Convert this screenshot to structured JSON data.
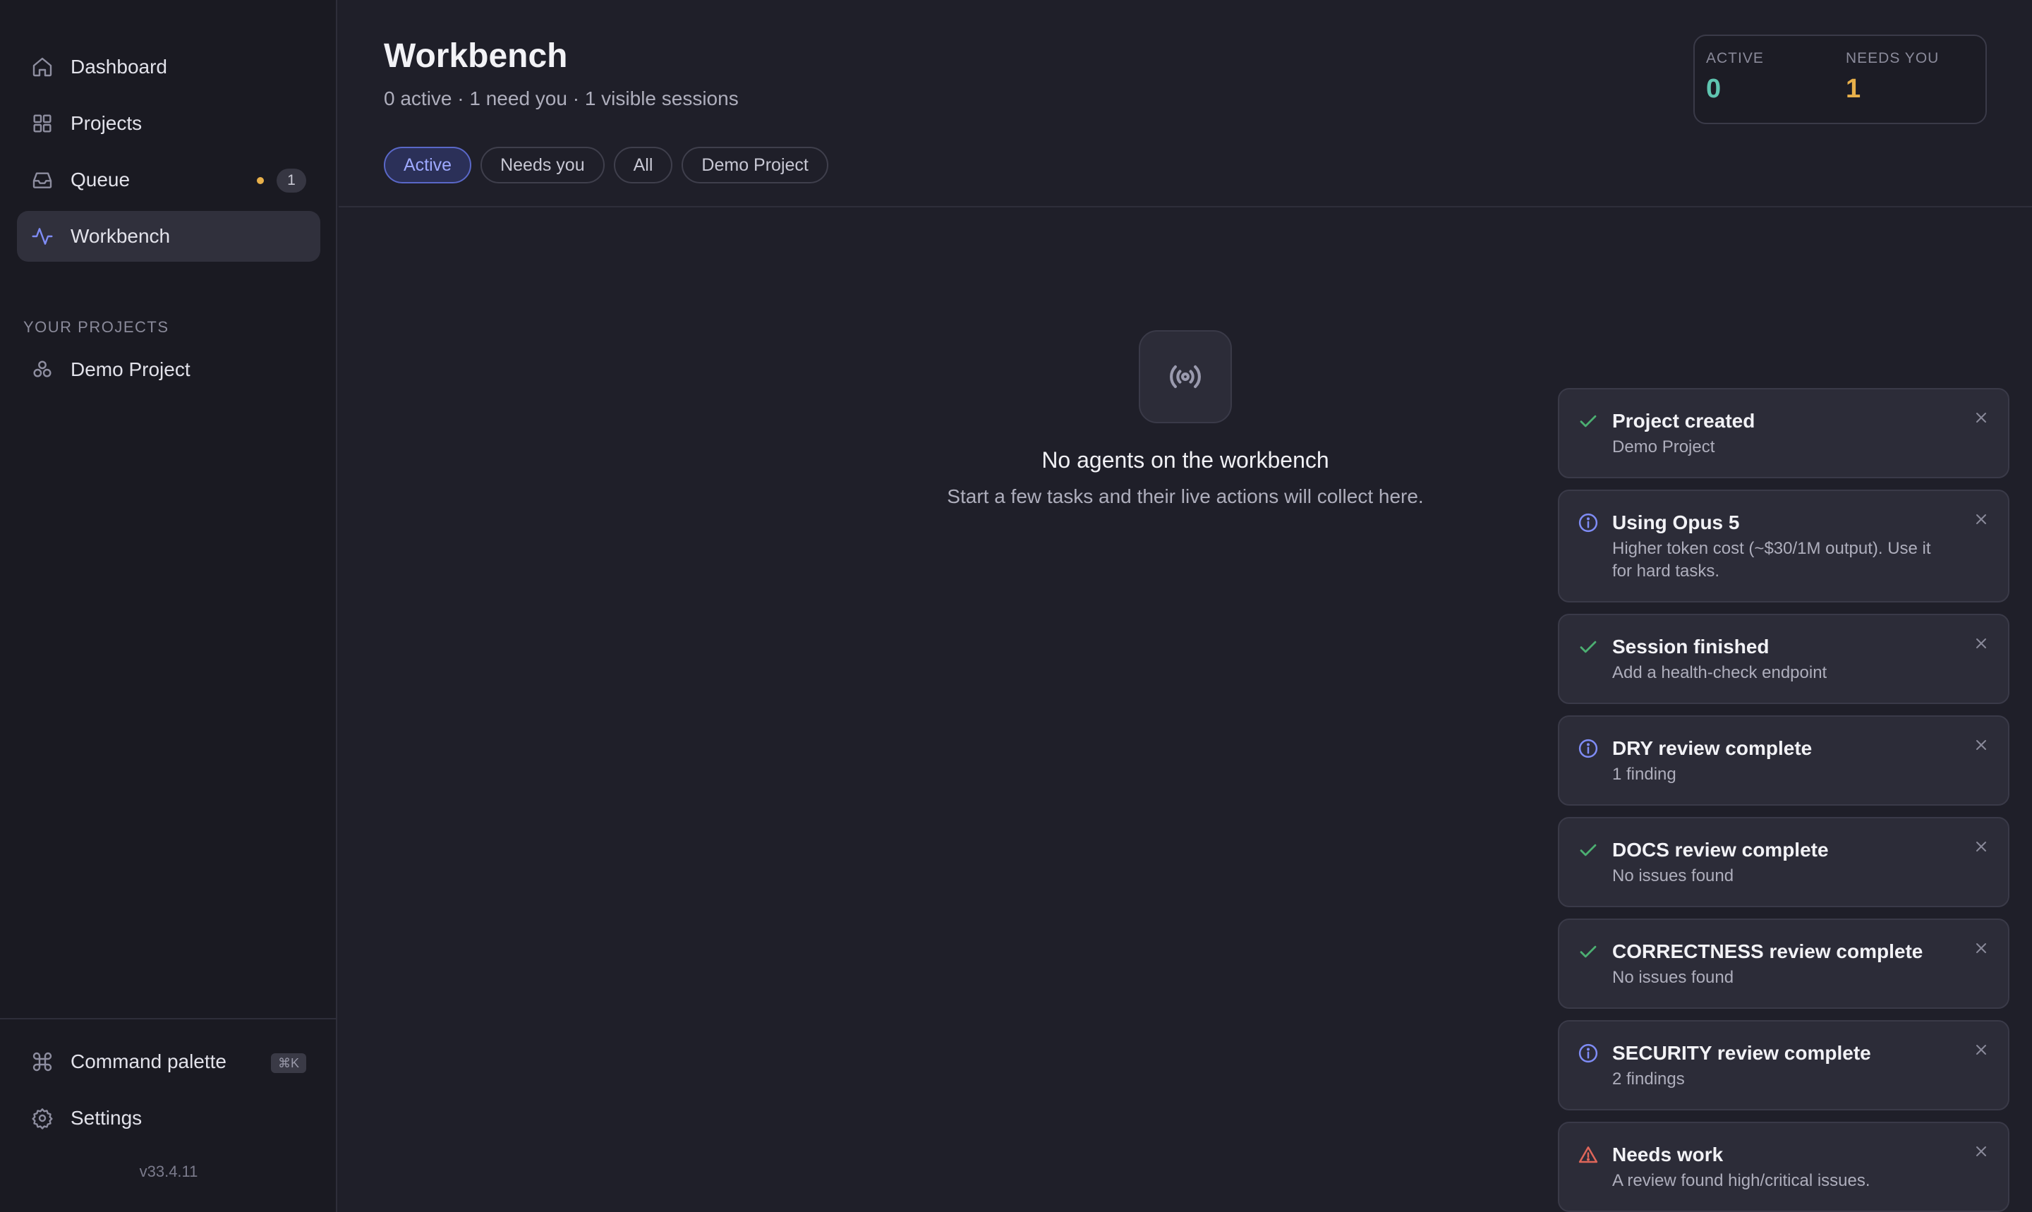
{
  "sidebar": {
    "nav": [
      {
        "label": "Dashboard",
        "icon": "home-icon"
      },
      {
        "label": "Projects",
        "icon": "grid-icon"
      },
      {
        "label": "Queue",
        "icon": "inbox-icon",
        "badge": "1"
      },
      {
        "label": "Workbench",
        "icon": "activity-icon",
        "active": true
      }
    ],
    "section_label": "YOUR PROJECTS",
    "projects": [
      {
        "label": "Demo Project",
        "icon": "cluster-icon"
      }
    ],
    "command_palette": {
      "label": "Command palette",
      "shortcut": "⌘K"
    },
    "settings": {
      "label": "Settings"
    },
    "version": "v33.4.11"
  },
  "header": {
    "title": "Workbench",
    "subtitle": "0 active · 1 need you · 1 visible sessions",
    "stats": {
      "active_label": "ACTIVE",
      "active_value": "0",
      "needs_label": "NEEDS YOU",
      "needs_value": "1"
    },
    "filters": [
      {
        "label": "Active",
        "active": true
      },
      {
        "label": "Needs you"
      },
      {
        "label": "All"
      },
      {
        "label": "Demo Project"
      }
    ]
  },
  "empty_state": {
    "icon": "broadcast-icon",
    "title": "No agents on the workbench",
    "description": "Start a few tasks and their live actions will collect here."
  },
  "toasts": [
    {
      "type": "success",
      "title": "Project created",
      "description": "Demo Project"
    },
    {
      "type": "info",
      "title": "Using Opus 5",
      "description": "Higher token cost (~$30/1M output). Use it for hard tasks."
    },
    {
      "type": "success",
      "title": "Session finished",
      "description": "Add a health-check endpoint"
    },
    {
      "type": "info",
      "title": "DRY review complete",
      "description": "1 finding"
    },
    {
      "type": "success",
      "title": "DOCS review complete",
      "description": "No issues found"
    },
    {
      "type": "success",
      "title": "CORRECTNESS review complete",
      "description": "No issues found"
    },
    {
      "type": "info",
      "title": "SECURITY review complete",
      "description": "2 findings"
    },
    {
      "type": "warning",
      "title": "Needs work",
      "description": "A review found high/critical issues."
    }
  ],
  "colors": {
    "accent": "#7f8cf5",
    "success": "#4caf72",
    "info": "#7f8cf5",
    "warning": "#e0665a",
    "active_stat": "#5fc4b0",
    "needs_stat": "#e8b04a",
    "queue_dot": "#e8b04a"
  }
}
